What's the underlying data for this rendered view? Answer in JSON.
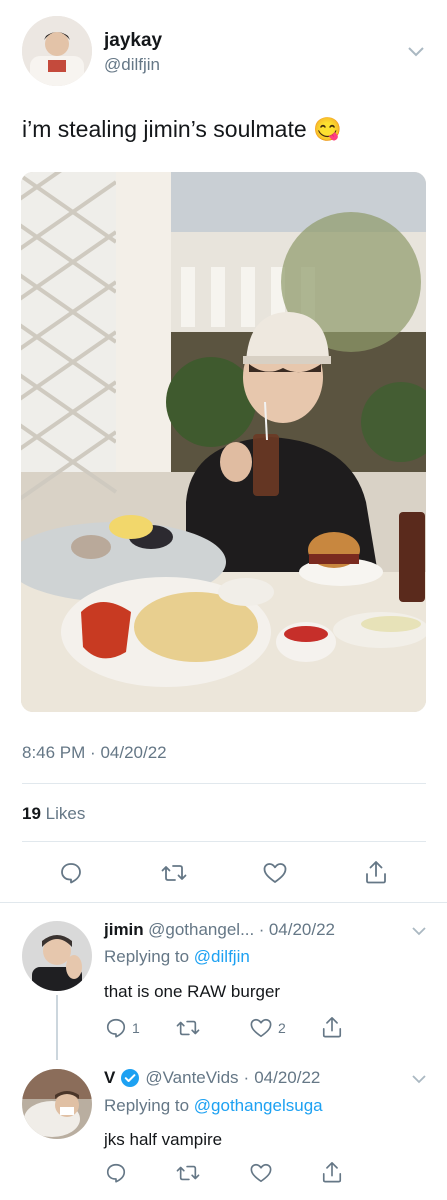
{
  "main_tweet": {
    "display_name": "jaykay",
    "handle": "@dilfjin",
    "text": "i’m stealing jimin’s soulmate 😋",
    "time": "8:46 PM",
    "sep": "·",
    "date": "04/20/22",
    "likes_count": "19",
    "likes_label": "Likes"
  },
  "replies": [
    {
      "display_name": "jimin",
      "handle": "@gothangel...",
      "sep": "·",
      "date": "04/20/22",
      "replying_prefix": "Replying to",
      "replying_to": "@dilfjin",
      "text": "that is one RAW burger",
      "reply_count": "1",
      "like_count": "2"
    },
    {
      "display_name": "V",
      "verified": true,
      "handle": "@VanteVids",
      "sep": "·",
      "date": "04/20/22",
      "replying_prefix": "Replying to",
      "replying_to": "@gothangelsuga",
      "text": "jks half vampire"
    }
  ],
  "icons": [
    "reply-icon",
    "retweet-icon",
    "like-icon",
    "share-icon",
    "chevron-down-icon",
    "verified-badge-icon"
  ],
  "colors": {
    "link": "#1da1f2",
    "muted": "#657786",
    "divider": "#e1e8ed"
  }
}
